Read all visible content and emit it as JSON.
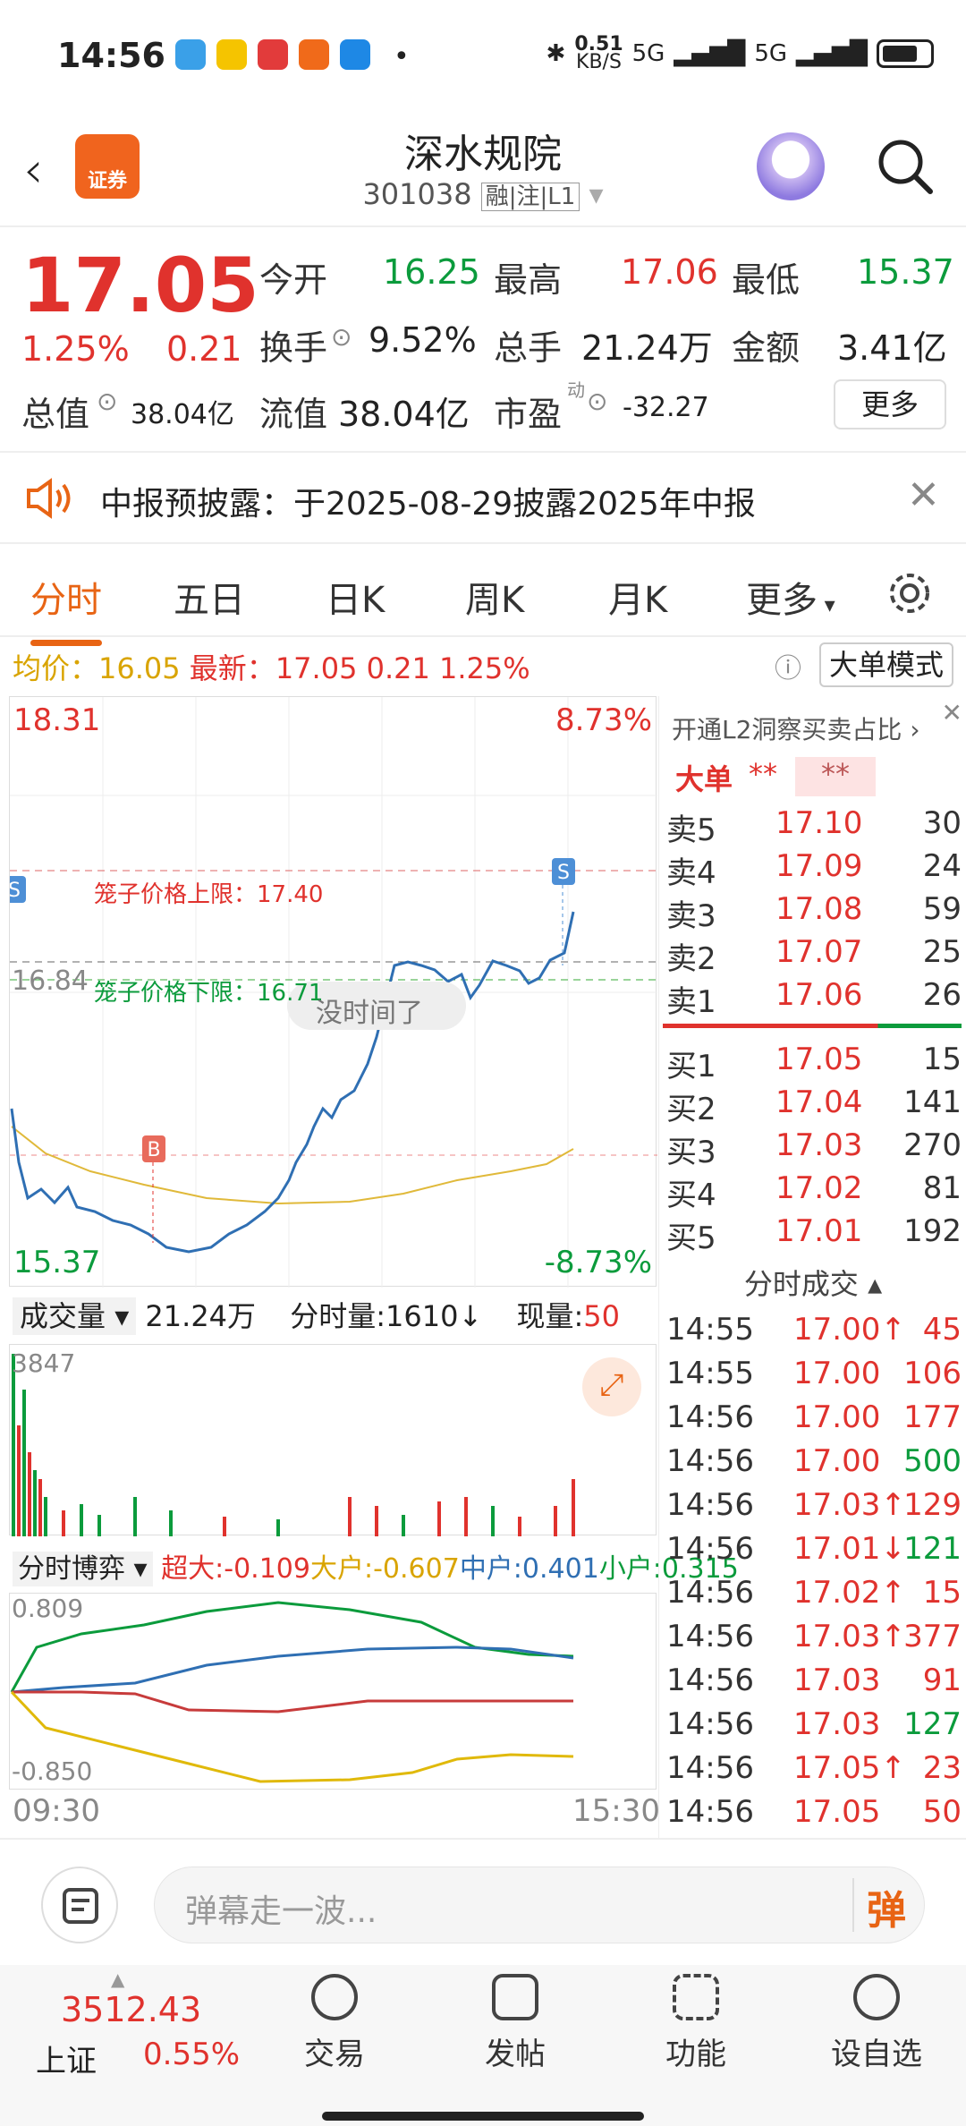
{
  "status": {
    "time": "14:56",
    "net_speed": "0.51",
    "net_unit": "KB/S",
    "sig1": "5G",
    "sig2": "5G"
  },
  "header": {
    "logo_text": "证券",
    "name": "深水规院",
    "code": "301038",
    "tags": "融|注|L1"
  },
  "quote": {
    "price": "17.05",
    "pct": "1.25%",
    "change": "0.21",
    "open_label": "今开",
    "open": "16.25",
    "high_label": "最高",
    "high": "17.06",
    "low_label": "最低",
    "low": "15.37",
    "turnover_label": "换手",
    "turnover": "9.52%",
    "volume_label": "总手",
    "volume": "21.24万",
    "amount_label": "金额",
    "amount": "3.41亿",
    "mktcap_label": "总值",
    "mktcap": "38.04亿",
    "float_label": "流值",
    "float": "38.04亿",
    "pe_label": "市盈",
    "pe_sup": "动",
    "pe": "-32.27",
    "more": "更多"
  },
  "notice": {
    "text": "中报预披露：于2025-08-29披露2025年中报"
  },
  "tabs": [
    "分时",
    "五日",
    "日K",
    "周K",
    "月K",
    "更多"
  ],
  "avg": {
    "avg_label": "均价：",
    "avg": "16.05",
    "latest_label": "最新：",
    "latest": "17.05",
    "chg": "0.21",
    "pct": "1.25%",
    "bigmode": "大单模式"
  },
  "chart": {
    "ymax": "18.31",
    "ymin": "15.37",
    "pmax": "8.73%",
    "pmin": "-8.73%",
    "y_mid": "16.84",
    "upper_limit": "笼子价格上限：17.40",
    "lower_limit": "笼子价格下限：16.71",
    "no_time": "没时间了",
    "buy_marker": "B",
    "sell_marker": "S",
    "vol_label": "成交量",
    "vol_total": "21.24万",
    "vol_minute": "分时量:1610↓",
    "vol_now_label": "现量:",
    "vol_now": "50",
    "vol_max": "3847",
    "game_label": "分时博弈",
    "super_label": "超大:",
    "super": "-0.109",
    "big_label": "大户:",
    "big": "-0.607",
    "mid_label": "中户:",
    "mid": "0.401",
    "small_label": "小户:",
    "small": "0.315",
    "g_top": "0.809",
    "g_bottom": "-0.850",
    "t_start": "09:30",
    "t_end": "15:30"
  },
  "orderbook": {
    "l2": "开通L2洞察买卖占比",
    "big": "大单",
    "stars1": "**",
    "stars2": "**",
    "asks": [
      [
        "卖5",
        "17.10",
        "30"
      ],
      [
        "卖4",
        "17.09",
        "24"
      ],
      [
        "卖3",
        "17.08",
        "59"
      ],
      [
        "卖2",
        "17.07",
        "25"
      ],
      [
        "卖1",
        "17.06",
        "26"
      ]
    ],
    "bids": [
      [
        "买1",
        "17.05",
        "15"
      ],
      [
        "买2",
        "17.04",
        "141"
      ],
      [
        "买3",
        "17.03",
        "270"
      ],
      [
        "买4",
        "17.02",
        "81"
      ],
      [
        "买5",
        "17.01",
        "192"
      ]
    ],
    "trades_title": "分时成交",
    "trades": [
      [
        "14:55",
        "17.00↑",
        "45",
        "r",
        "r"
      ],
      [
        "14:55",
        "17.00",
        "106",
        "r",
        "r"
      ],
      [
        "14:56",
        "17.00",
        "177",
        "r",
        "r"
      ],
      [
        "14:56",
        "17.00",
        "500",
        "r",
        "g"
      ],
      [
        "14:56",
        "17.03↑",
        "129",
        "r",
        "r"
      ],
      [
        "14:56",
        "17.01↓",
        "121",
        "r",
        "g"
      ],
      [
        "14:56",
        "17.02↑",
        "15",
        "r",
        "r"
      ],
      [
        "14:56",
        "17.03↑",
        "377",
        "r",
        "r"
      ],
      [
        "14:56",
        "17.03",
        "91",
        "r",
        "r"
      ],
      [
        "14:56",
        "17.03",
        "127",
        "r",
        "g"
      ],
      [
        "14:56",
        "17.05↑",
        "23",
        "r",
        "r"
      ],
      [
        "14:56",
        "17.05",
        "50",
        "r",
        "r"
      ]
    ]
  },
  "comment": {
    "placeholder": "弹幕走一波...",
    "danmu": "弹"
  },
  "bottom": {
    "index": "3512.43",
    "index_name": "上证",
    "index_pct": "0.55%",
    "nav": [
      "交易",
      "发帖",
      "功能",
      "设自选"
    ]
  }
}
